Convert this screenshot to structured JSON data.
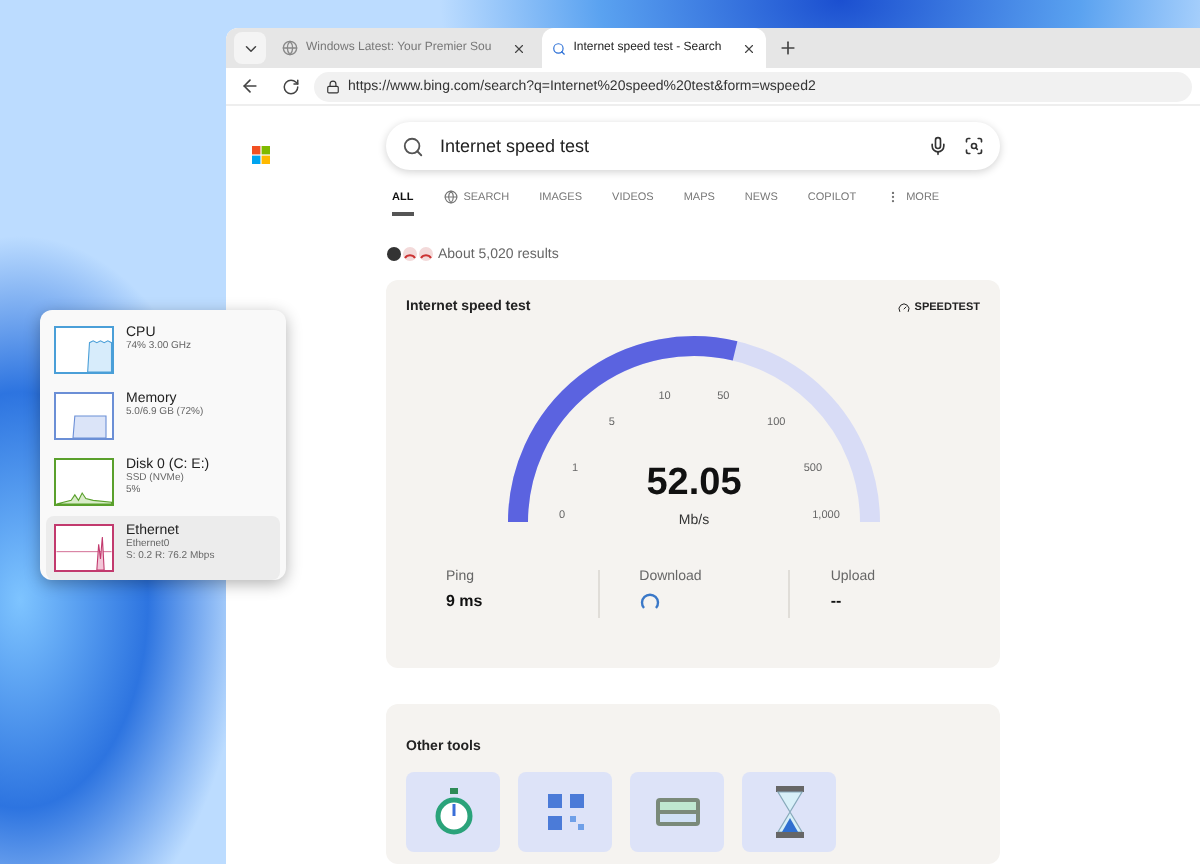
{
  "browser": {
    "tabs": [
      {
        "title": "Windows Latest: Your Premier Sou",
        "selected": false,
        "kind": "site"
      },
      {
        "title": "Internet speed test - Search",
        "selected": true,
        "kind": "search"
      }
    ],
    "address": "https://www.bing.com/search?q=Internet%20speed%20test&form=wspeed2"
  },
  "search": {
    "value": "Internet speed test"
  },
  "nav": [
    {
      "label": "ALL",
      "selected": true,
      "kind": "plain"
    },
    {
      "label": "SEARCH",
      "selected": false,
      "kind": "copilot"
    },
    {
      "label": "IMAGES",
      "selected": false,
      "kind": "plain"
    },
    {
      "label": "VIDEOS",
      "selected": false,
      "kind": "plain"
    },
    {
      "label": "MAPS",
      "selected": false,
      "kind": "plain"
    },
    {
      "label": "NEWS",
      "selected": false,
      "kind": "plain"
    },
    {
      "label": "COPILOT",
      "selected": false,
      "kind": "plain"
    },
    {
      "label": "MORE",
      "selected": false,
      "kind": "more"
    }
  ],
  "results_count": "About 5,020 results",
  "speedtest": {
    "title": "Internet speed test",
    "brand": "SPEEDTEST",
    "level": 0.575,
    "value": "52.05",
    "unit": "Mb/s",
    "scale": [
      "0",
      "1",
      "5",
      "10",
      "50",
      "100",
      "500",
      "1,000"
    ],
    "stats": [
      {
        "label": "Ping",
        "value": "9 ms",
        "kind": "text"
      },
      {
        "label": "Download",
        "kind": "spinner"
      },
      {
        "label": "Upload",
        "value": "--",
        "kind": "text"
      }
    ]
  },
  "other_tools": {
    "title": "Other tools",
    "tools": [
      {
        "kind": "stopwatch"
      },
      {
        "kind": "qr"
      },
      {
        "kind": "keyboard"
      },
      {
        "kind": "hourglass"
      }
    ]
  },
  "performance": [
    {
      "name": "CPU",
      "details": [
        "74% 3.00 GHz"
      ],
      "kind": "cpu",
      "color": "#4a9fd8",
      "selected": false
    },
    {
      "name": "Memory",
      "details": [
        "5.0/6.9 GB (72%)"
      ],
      "kind": "memory",
      "color": "#6b8fd6",
      "selected": false
    },
    {
      "name": "Disk 0 (C: E:)",
      "details": [
        "SSD (NVMe)",
        "5%"
      ],
      "kind": "disk",
      "color": "#5aa02c",
      "selected": false
    },
    {
      "name": "Ethernet",
      "details": [
        "Ethernet0",
        "S: 0.2 R: 76.2 Mbps"
      ],
      "kind": "ethernet",
      "color": "#c23a6e",
      "selected": true
    }
  ]
}
